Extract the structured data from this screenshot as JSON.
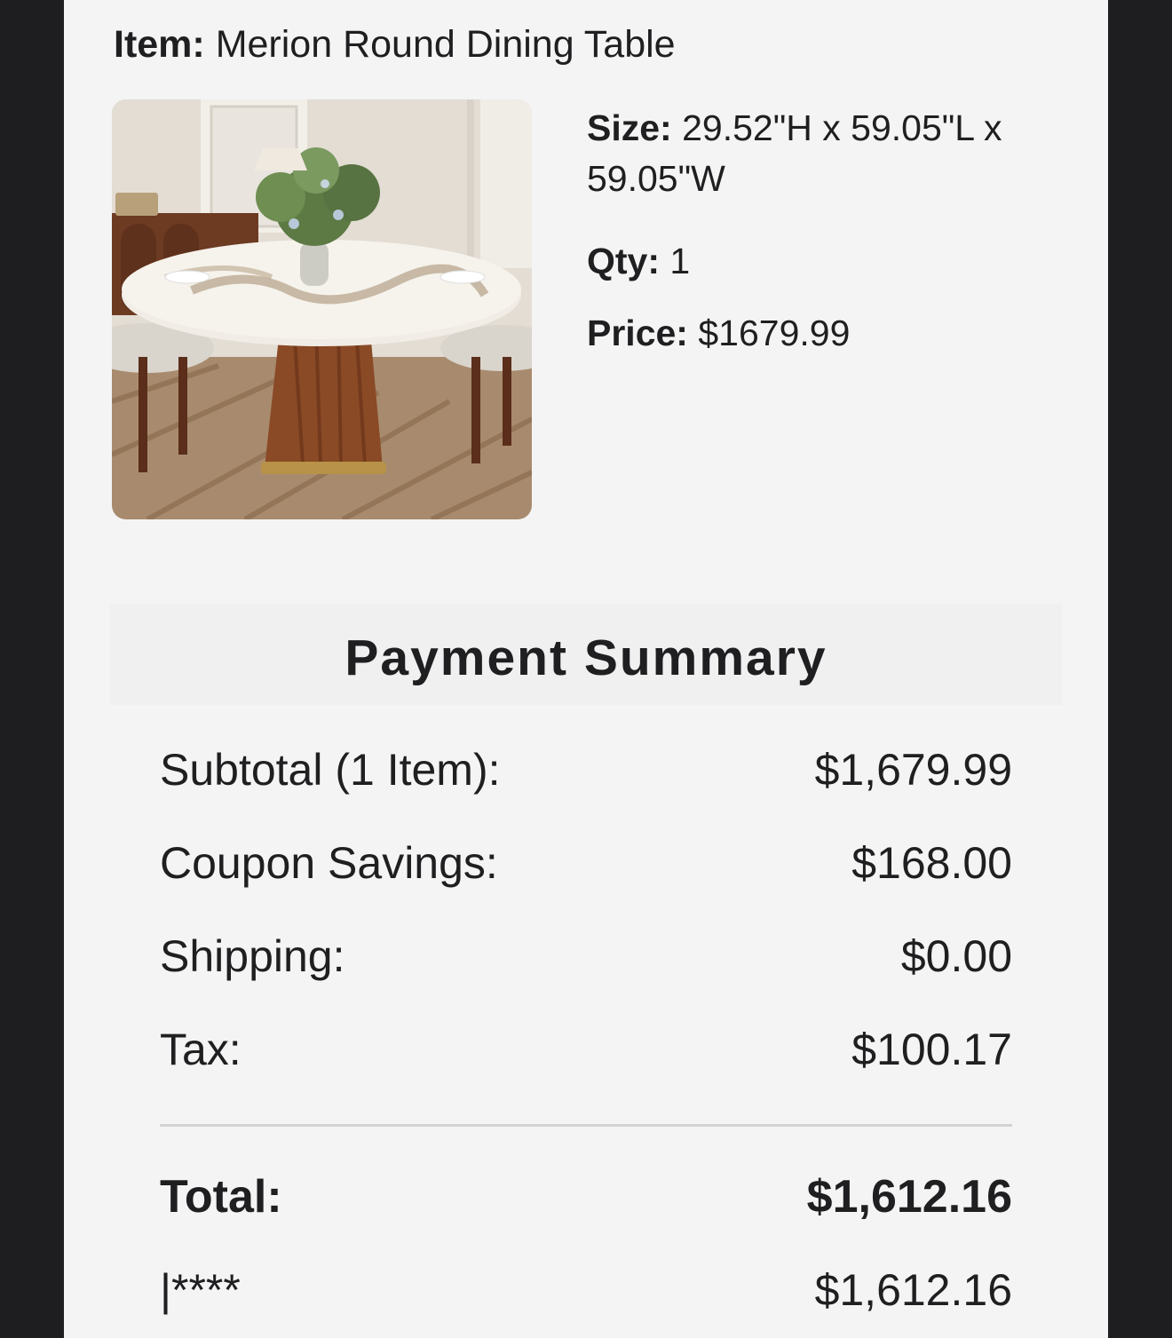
{
  "item": {
    "label": "Item:",
    "name": "Merion Round Dining Table",
    "image_icon": "dining-table-photo"
  },
  "details": {
    "size_label": "Size:",
    "size_value": "29.52\"H x 59.05\"L x 59.05\"W",
    "qty_label": "Qty:",
    "qty_value": "1",
    "price_label": "Price:",
    "price_value": "$1679.99"
  },
  "summary": {
    "title": "Payment Summary",
    "rows": [
      {
        "label": "Subtotal (1 Item):",
        "value": "$1,679.99"
      },
      {
        "label": "Coupon Savings:",
        "value": "$168.00"
      },
      {
        "label": "Shipping:",
        "value": "$0.00"
      },
      {
        "label": "Tax:",
        "value": "$100.17"
      }
    ],
    "total_label": "Total:",
    "total_value": "$1,612.16",
    "payment_method": "|****",
    "payment_value": "$1,612.16"
  },
  "colors": {
    "page_bg": "#f4f4f4",
    "outer_bg": "#1e1e20",
    "text": "#1f1f21",
    "divider": "#d2d2d2"
  }
}
